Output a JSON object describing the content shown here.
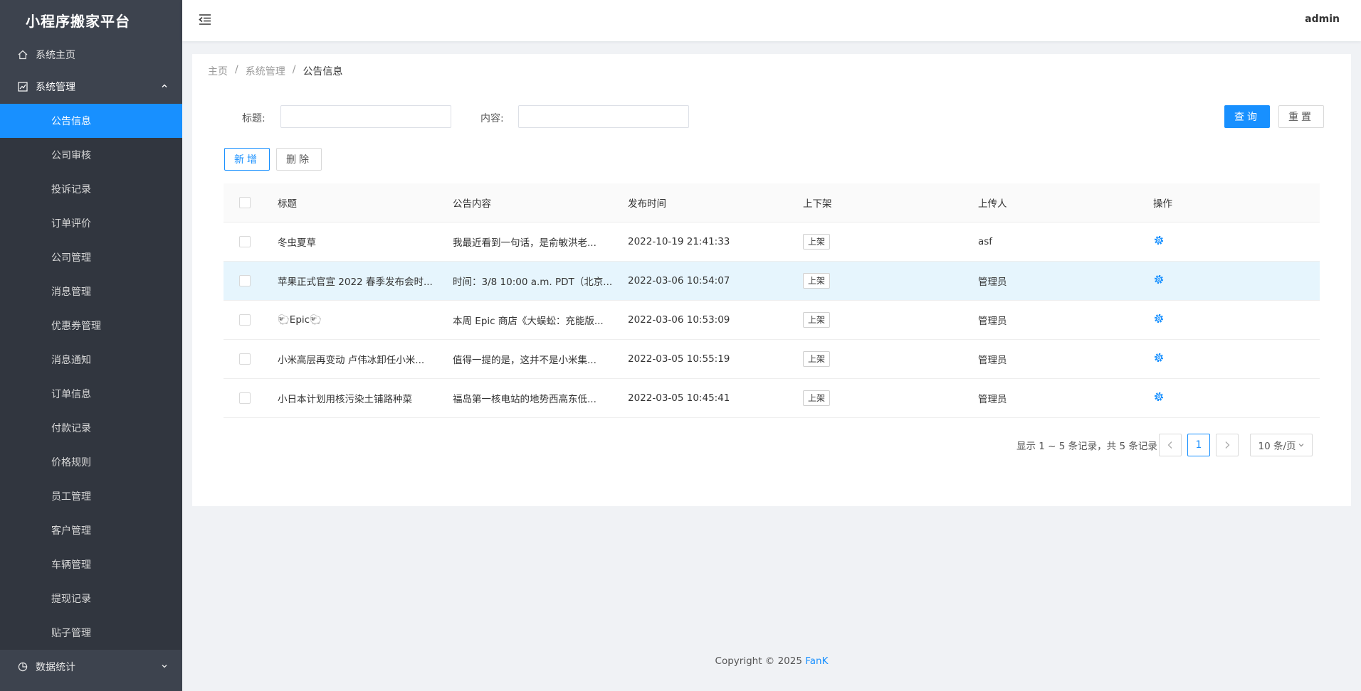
{
  "app": {
    "title": "小程序搬家平台"
  },
  "sidebar": {
    "home": {
      "label": "系统主页",
      "icon": "home-icon"
    },
    "group": {
      "label": "系统管理",
      "icon": "chart-icon"
    },
    "items": [
      {
        "label": "公告信息",
        "active": true
      },
      {
        "label": "公司审核"
      },
      {
        "label": "投诉记录"
      },
      {
        "label": "订单评价"
      },
      {
        "label": "公司管理"
      },
      {
        "label": "消息管理"
      },
      {
        "label": "优惠券管理"
      },
      {
        "label": "消息通知"
      },
      {
        "label": "订单信息"
      },
      {
        "label": "付款记录"
      },
      {
        "label": "价格规则"
      },
      {
        "label": "员工管理"
      },
      {
        "label": "客户管理"
      },
      {
        "label": "车辆管理"
      },
      {
        "label": "提现记录"
      },
      {
        "label": "贴子管理"
      }
    ],
    "bottom": {
      "label": "数据统计",
      "icon": "pie-chart-icon"
    }
  },
  "header": {
    "user": "admin"
  },
  "breadcrumb": [
    "主页",
    "系统管理",
    "公告信息"
  ],
  "search": {
    "title_label": "标题:",
    "title_value": "",
    "content_label": "内容:",
    "content_value": "",
    "query_label": "查询",
    "reset_label": "重置"
  },
  "toolbar": {
    "add_label": "新增",
    "delete_label": "删除"
  },
  "table": {
    "columns": [
      "标题",
      "公告内容",
      "发布时间",
      "上下架",
      "上传人",
      "操作"
    ],
    "rows": [
      {
        "title": "冬虫夏草",
        "content": "我最近看到一句话，是俞敏洪老...",
        "time": "2022-10-19 21:41:33",
        "status": "上架",
        "uploader": "asf"
      },
      {
        "title": "苹果正式官宣 2022 春季发布会时...",
        "content": "时间：3/8 10:00 a.m. PDT（北京...",
        "time": "2022-03-06 10:54:07",
        "status": "上架",
        "uploader": "管理员"
      },
      {
        "title": "🐑Epic🐑",
        "content": "本周 Epic 商店《大蜈蚣：充能版...",
        "time": "2022-03-06 10:53:09",
        "status": "上架",
        "uploader": "管理员"
      },
      {
        "title": "小米高层再变动 卢伟冰卸任小米...",
        "content": "值得一提的是，这并不是小米集...",
        "time": "2022-03-05 10:55:19",
        "status": "上架",
        "uploader": "管理员"
      },
      {
        "title": "小日本计划用核污染土铺路种菜",
        "content": "福岛第一核电站的地势西高东低...",
        "time": "2022-03-05 10:45:41",
        "status": "上架",
        "uploader": "管理员"
      }
    ]
  },
  "pagination": {
    "summary": "显示 1 ~ 5 条记录，共 5 条记录",
    "current": "1",
    "page_size": "10 条/页"
  },
  "footer": {
    "prefix": "Copyright © 2025 ",
    "brand": "FanK"
  },
  "colors": {
    "primary": "#1890ff",
    "sidebar_bg": "#3d434e",
    "sidebar_sub_bg": "#31363f",
    "row_highlight": "#e6f5fd"
  }
}
